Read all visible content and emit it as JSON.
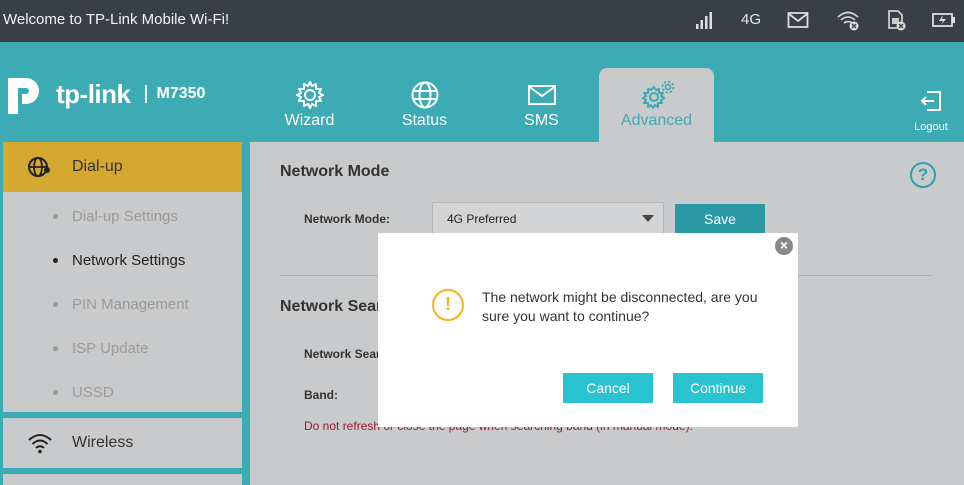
{
  "status_bar": {
    "welcome": "Welcome to TP-Link Mobile Wi-Fi!",
    "network_type": "4G",
    "icons": [
      "signal-icon",
      "mail-icon",
      "wifi-off-icon",
      "sim-off-icon",
      "battery-charging-icon"
    ]
  },
  "header": {
    "brand": "tp-link",
    "model": "M7350",
    "tabs": [
      {
        "label": "Wizard",
        "icon": "gear-icon"
      },
      {
        "label": "Status",
        "icon": "globe-icon"
      },
      {
        "label": "SMS",
        "icon": "envelope-icon"
      },
      {
        "label": "Advanced",
        "icon": "gears-icon",
        "active": true
      }
    ],
    "logout_label": "Logout"
  },
  "sidebar": {
    "dialup": {
      "label": "Dial-up",
      "items": [
        {
          "label": "Dial-up Settings"
        },
        {
          "label": "Network Settings",
          "current": true
        },
        {
          "label": "PIN Management"
        },
        {
          "label": "ISP Update"
        },
        {
          "label": "USSD"
        }
      ]
    },
    "wireless": {
      "label": "Wireless"
    }
  },
  "main": {
    "network_mode": {
      "title": "Network Mode",
      "field_label": "Network Mode:",
      "selected": "4G Preferred",
      "save_label": "Save"
    },
    "network_search": {
      "title": "Network Sear",
      "field_label": "Network Sear",
      "band_label": "Band:",
      "warning_visible": "Do not refresh or close the page when searching band (in manual mode)."
    },
    "help_label": "?"
  },
  "modal": {
    "message": "The network might be disconnected, are you sure you want to continue?",
    "cancel_label": "Cancel",
    "continue_label": "Continue",
    "close_glyph": "×",
    "warn_glyph": "!"
  },
  "colors": {
    "teal": "#3cabb4",
    "active_yellow": "#d5a832",
    "button_cyan": "#29c4cf",
    "warning_red": "#9c1a2e",
    "status_bar": "#3a3f45"
  }
}
